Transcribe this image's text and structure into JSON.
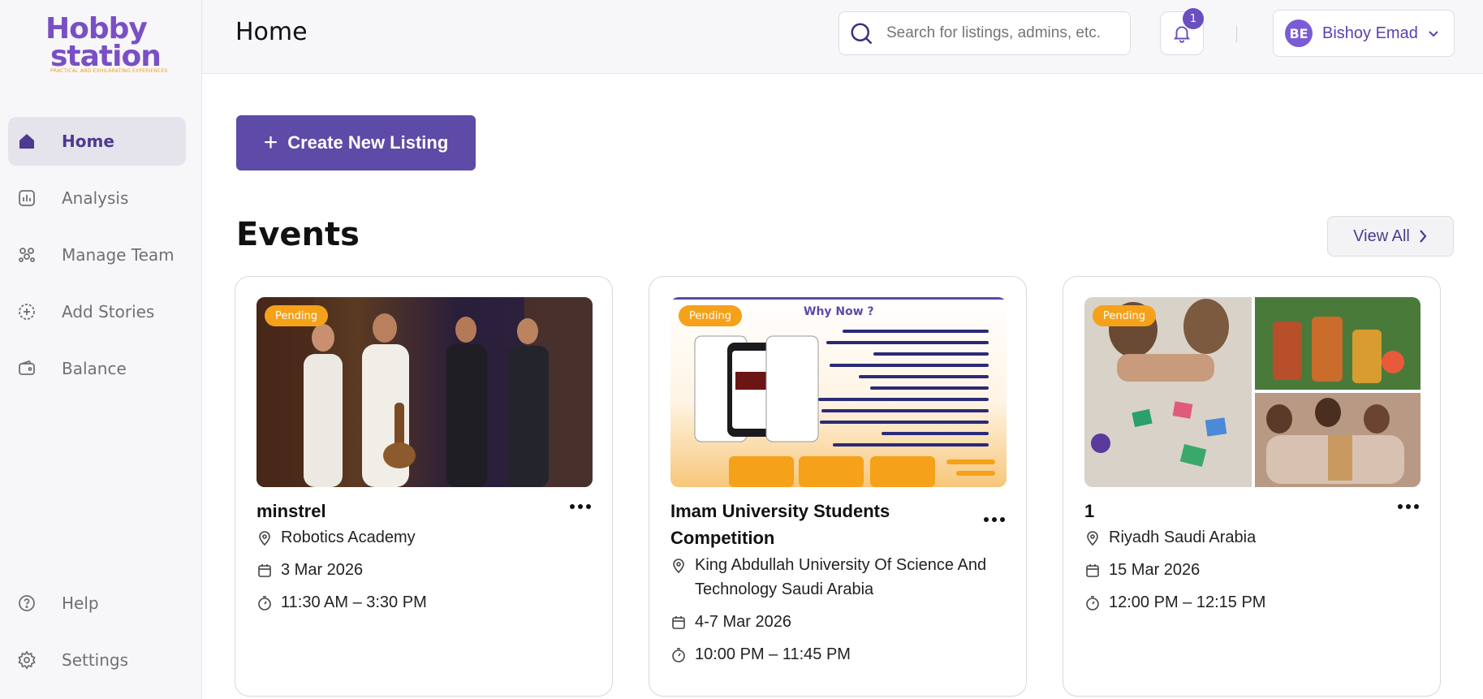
{
  "app": {
    "logo_line1": "Hobby",
    "logo_line2": "station",
    "logo_tagline": "PRACTICAL AND EXHILARATING EXPERIENCES"
  },
  "sidebar": {
    "items": [
      {
        "label": "Home",
        "icon": "home-icon",
        "active": true
      },
      {
        "label": "Analysis",
        "icon": "analysis-icon"
      },
      {
        "label": "Manage Team",
        "icon": "team-icon"
      },
      {
        "label": "Add Stories",
        "icon": "add-story-icon"
      },
      {
        "label": "Balance",
        "icon": "wallet-icon"
      }
    ],
    "bottom": [
      {
        "label": "Help",
        "icon": "help-icon"
      },
      {
        "label": "Settings",
        "icon": "gear-icon"
      }
    ]
  },
  "header": {
    "title": "Home",
    "search_placeholder": "Search for listings, admins, etc.",
    "notifications_count": "1",
    "user_initials": "BE",
    "user_name": "Bishoy Emad"
  },
  "main": {
    "create_label": "Create New Listing",
    "section_title": "Events",
    "view_all_label": "View All"
  },
  "events": [
    {
      "status": "Pending",
      "title": "minstrel",
      "location": "Robotics Academy",
      "date": "3 Mar 2026",
      "time": "11:30 AM – 3:30 PM"
    },
    {
      "status": "Pending",
      "title": "Imam University Students Competition",
      "location": "King Abdullah University Of Science And Technology Saudi Arabia",
      "date": "4-7 Mar 2026",
      "time": "10:00 PM – 11:45 PM",
      "poster_heading": "Why Now ?"
    },
    {
      "status": "Pending",
      "title": "1",
      "location": "Riyadh Saudi Arabia",
      "date": "15 Mar 2026",
      "time": "12:00 PM – 12:15 PM"
    }
  ],
  "colors": {
    "brand_purple": "#5e4aa7",
    "pending_orange": "#f5a11a",
    "sidebar_bg": "#f7f7f9"
  }
}
